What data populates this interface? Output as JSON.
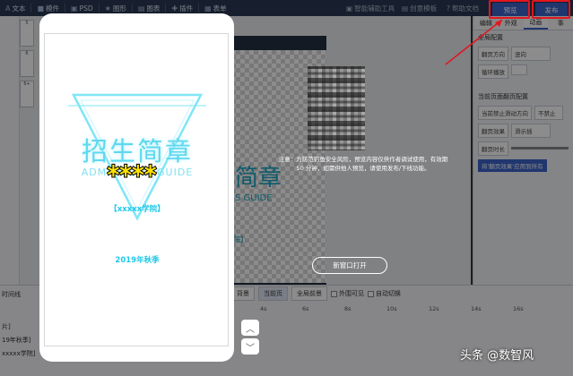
{
  "toolbar": {
    "items": [
      {
        "icon": "A",
        "label": "文本"
      },
      {
        "icon": "■",
        "label": "模件"
      },
      {
        "icon": "▣",
        "label": "PSD"
      },
      {
        "icon": "★",
        "label": "图形"
      },
      {
        "icon": "▤",
        "label": "图表"
      },
      {
        "icon": "✚",
        "label": "插件"
      },
      {
        "icon": "▦",
        "label": "表单"
      }
    ],
    "right_links": [
      "智能辅助工具",
      "创意模板",
      "帮助文档"
    ],
    "preview_label": "预览",
    "publish_label": "发布"
  },
  "thumbnails": [
    "5",
    "6",
    "6+"
  ],
  "right_panel": {
    "tabs": [
      "编辑",
      "外观",
      "动画",
      "事"
    ],
    "global_title": "全局配置",
    "page_direction_label": "翻页方向",
    "page_direction_value": "竖向",
    "loop_label": "循环播放",
    "current_title": "当前页面翻页配置",
    "no_swipe_label": "当前禁止滑动方向",
    "no_swipe_value": "不禁止",
    "effect_label": "翻页效果",
    "effect_value": "滑示插",
    "duration_label": "翻页时长",
    "apply_all_label": "将'翻页效果'应用到所有"
  },
  "timeline": {
    "buttons": [
      "背景",
      "当前页",
      "全局前景"
    ],
    "checks": [
      "外围可见",
      "自动切换"
    ],
    "ticks": [
      "4s",
      "6s",
      "8s",
      "10s",
      "12s",
      "14s",
      "16s"
    ],
    "left_labels": [
      "时间线",
      "片]",
      "19年秋季]",
      "xxxxx学院]"
    ]
  },
  "preview": {
    "title": "招生简章",
    "subtitle": "ADMISSIONS GUIDE",
    "school": "【xxxxx学院】",
    "season": "2019年秋季"
  },
  "background_stage": {
    "title": "简章",
    "subtitle": "S GUIDE",
    "tag": "院】"
  },
  "notice": {
    "text": "注意：为防范钓鱼安全风险，预览内容仅供作者调试使用，有效期 50 分钟，如需供他人预览，请使用发布/下线功能。",
    "open_new_window": "新窗口打开"
  },
  "watermark": "头条 @数智风"
}
